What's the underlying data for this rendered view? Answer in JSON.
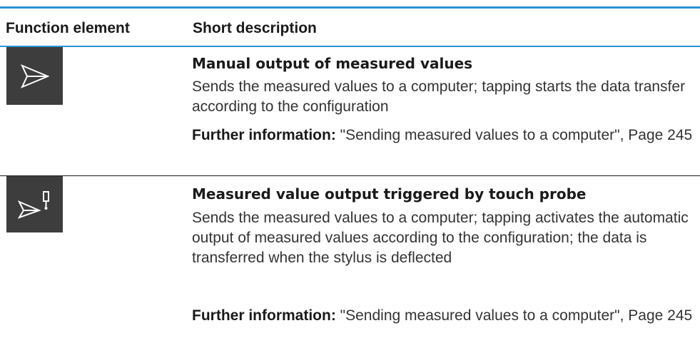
{
  "header": {
    "col1": "Function element",
    "col2": "Short description"
  },
  "rows": [
    {
      "icon": "send-icon",
      "title": "Manual output of measured values",
      "description": "Sends the measured values to a computer; tapping starts the data transfer according to the configuration",
      "further_label": "Further information:",
      "further_text": " \"Sending measured values to a computer\", Page 245"
    },
    {
      "icon": "send-touch-probe-icon",
      "title": "Measured value output triggered by touch probe",
      "description": "Sends the measured values to a computer; tapping activates the automatic output of measured values according to the configuration; the data is transferred when the stylus is deflected",
      "further_label": "Further information:",
      "further_text": " \"Sending measured values to a computer\", Page 245"
    }
  ],
  "colors": {
    "accent_rule": "#2b93d6",
    "icon_tile": "#3d3d3d",
    "icon_stroke": "#ffffff"
  }
}
